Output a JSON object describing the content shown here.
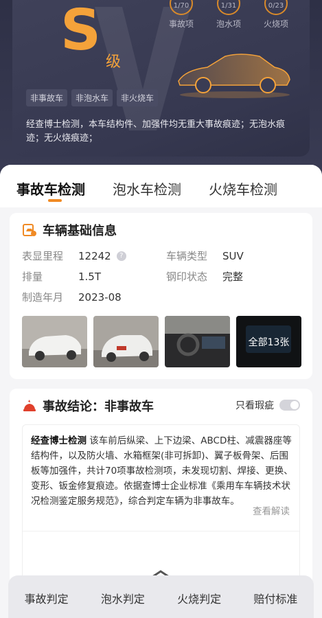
{
  "hero": {
    "grade_letter": "S",
    "grade_suffix": "级",
    "counters": [
      {
        "value": "1/70",
        "label": "事故项"
      },
      {
        "value": "1/31",
        "label": "泡水项"
      },
      {
        "value": "0/23",
        "label": "火烧项"
      }
    ],
    "tags": [
      "非事故车",
      "非泡水车",
      "非火烧车"
    ],
    "summary": "经查博士检测，本车结构件、加强件均无重大事故痕迹；无泡水痕迹；无火烧痕迹；"
  },
  "tabs": [
    {
      "label": "事故车检测",
      "active": true
    },
    {
      "label": "泡水车检测",
      "active": false
    },
    {
      "label": "火烧车检测",
      "active": false
    }
  ],
  "basic_info": {
    "title": "车辆基础信息",
    "mileage_label": "表显里程",
    "mileage_value": "12242",
    "displacement_label": "排量",
    "displacement_value": "1.5T",
    "year_label": "制造年月",
    "year_value": "2023-08",
    "type_label": "车辆类型",
    "type_value": "SUV",
    "stamp_label": "钢印状态",
    "stamp_value": "完整",
    "photos_more": "全部13张"
  },
  "conclusion": {
    "title": "事故结论：非事故车",
    "toggle_label": "只看瑕疵",
    "brand": "经查博士检测",
    "text": " 该车前后纵梁、上下边梁、ABCD柱、减震器座等结构件，以及防火墙、水箱框架(非可拆卸)、翼子板骨架、后围板等加强件，共计70项事故检测项，未发现切割、焊接、更换、变形、钣金修复痕迹。依据查博士企业标准《乘用车车辆技术状况检测鉴定服务规范》，综合判定车辆为非事故车。",
    "read_more": "查看解读"
  },
  "bottom_bar": [
    "事故判定",
    "泡水判定",
    "火烧判定",
    "赔付标准"
  ],
  "colors": {
    "accent": "#f08a24",
    "hero_bg": "#363850",
    "grade": "#f4a23a"
  },
  "icons": [
    "car-check-icon",
    "crash-icon",
    "question-icon",
    "chevron-up-icon",
    "car-illustration"
  ]
}
